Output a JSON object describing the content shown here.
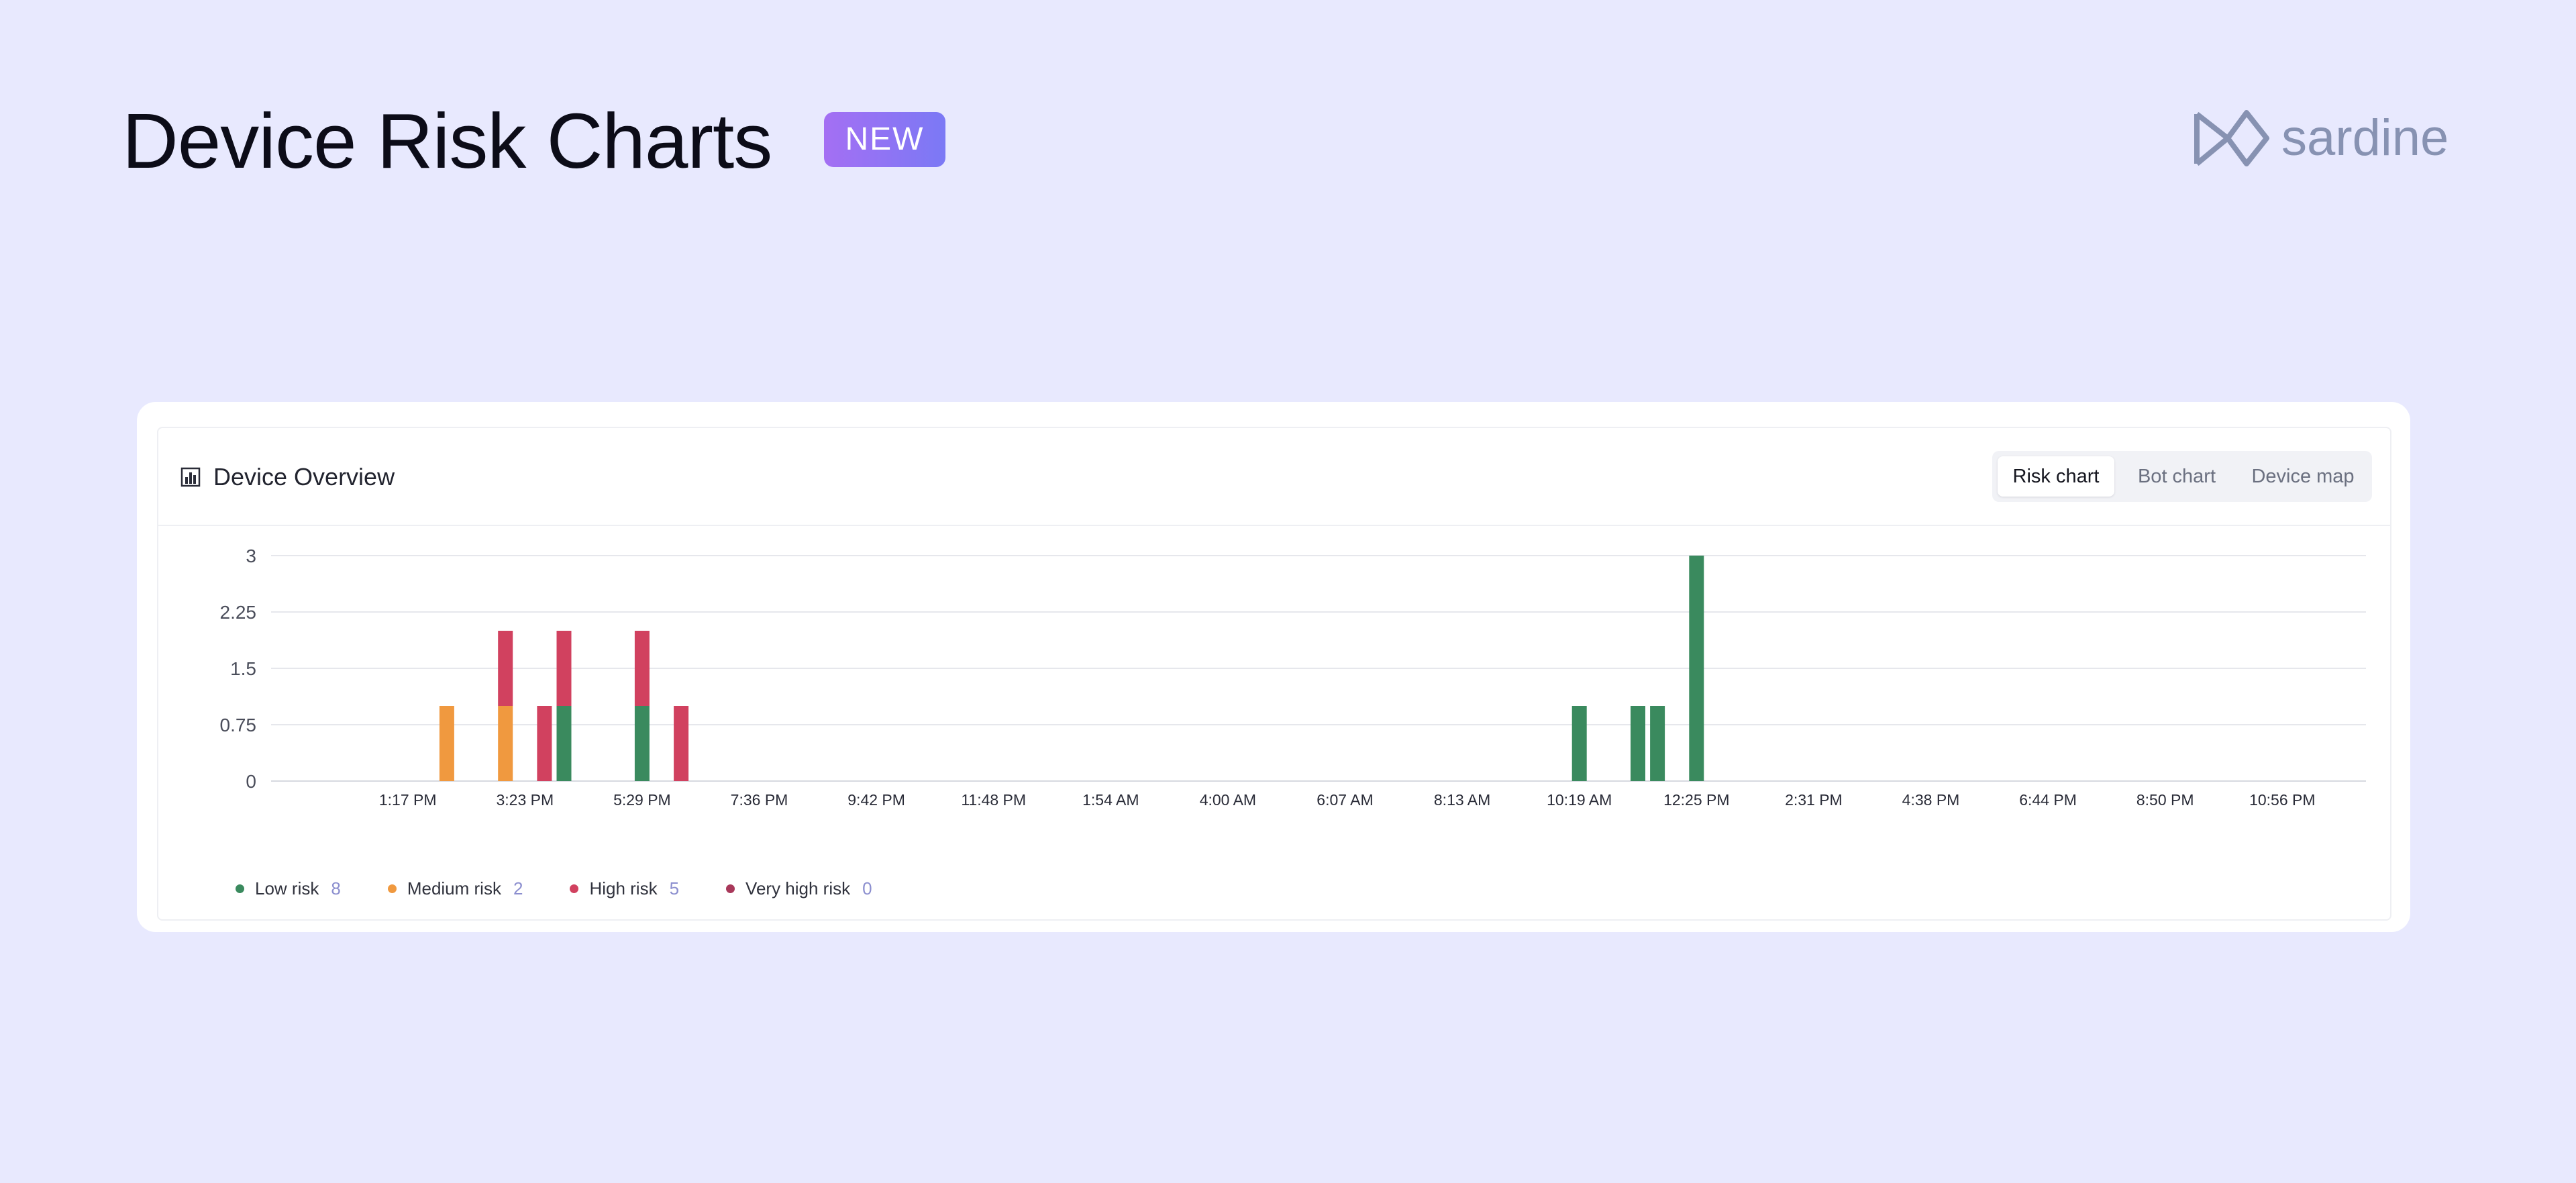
{
  "page": {
    "title": "Device Risk Charts",
    "badge": "NEW"
  },
  "brand": {
    "name": "sardine",
    "logo_icon": "sardine-logo-icon"
  },
  "card": {
    "icon": "bar-chart-icon",
    "title": "Device Overview",
    "tabs": [
      {
        "label": "Risk chart",
        "active": true
      },
      {
        "label": "Bot chart",
        "active": false
      },
      {
        "label": "Device map",
        "active": false
      }
    ]
  },
  "colors": {
    "background": "#e8e9fe",
    "low": "#3a8a5e",
    "medium": "#f0993f",
    "high": "#d1415f",
    "very_high": "#a8385a",
    "badge_start": "#a46ff3",
    "badge_end": "#7b79f5",
    "legend_count": "#8c8fcf"
  },
  "legend": [
    {
      "label": "Low risk",
      "count": "8",
      "color": "#3a8a5e"
    },
    {
      "label": "Medium risk",
      "count": "2",
      "color": "#f0993f"
    },
    {
      "label": "High risk",
      "count": "5",
      "color": "#d1415f"
    },
    {
      "label": "Very high risk",
      "count": "0",
      "color": "#a8385a"
    }
  ],
  "chart_data": {
    "type": "bar",
    "stacked": true,
    "title": "",
    "xlabel": "",
    "ylabel": "",
    "ylim": [
      0,
      3
    ],
    "yticks": [
      "0",
      "0.75",
      "1.5",
      "2.25",
      "3"
    ],
    "grid": true,
    "legend_position": "bottom-left",
    "x_tick_labels": [
      "1:17 PM",
      "3:23 PM",
      "5:29 PM",
      "7:36 PM",
      "9:42 PM",
      "11:48 PM",
      "1:54 AM",
      "4:00 AM",
      "6:07 AM",
      "8:13 AM",
      "10:19 AM",
      "12:25 PM",
      "2:31 PM",
      "4:38 PM",
      "6:44 PM",
      "8:50 PM",
      "10:56 PM"
    ],
    "x_tick_first_index": 7,
    "x_tick_step": 6,
    "slot_count": 107,
    "series": [
      {
        "name": "Low risk",
        "color": "#3a8a5e",
        "points": [
          {
            "slot": 15,
            "value": 1
          },
          {
            "slot": 19,
            "value": 1
          },
          {
            "slot": 67,
            "value": 1
          },
          {
            "slot": 70,
            "value": 1
          },
          {
            "slot": 71,
            "value": 1
          },
          {
            "slot": 73,
            "value": 3
          }
        ]
      },
      {
        "name": "Medium risk",
        "color": "#f0993f",
        "points": [
          {
            "slot": 9,
            "value": 1
          },
          {
            "slot": 12,
            "value": 1
          }
        ]
      },
      {
        "name": "High risk",
        "color": "#d1415f",
        "points": [
          {
            "slot": 12,
            "value": 1
          },
          {
            "slot": 14,
            "value": 1
          },
          {
            "slot": 15,
            "value": 1
          },
          {
            "slot": 19,
            "value": 1
          },
          {
            "slot": 21,
            "value": 1
          }
        ]
      },
      {
        "name": "Very high risk",
        "color": "#a8385a",
        "points": []
      }
    ]
  }
}
